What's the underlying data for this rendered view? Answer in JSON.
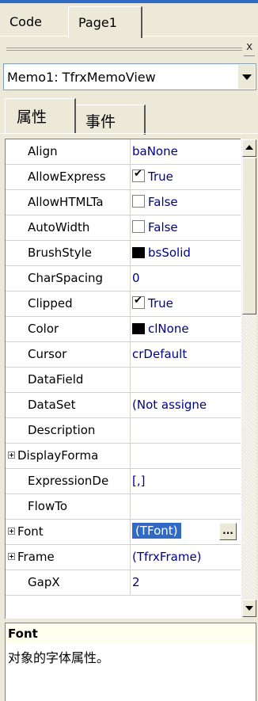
{
  "tabs": {
    "code": "Code",
    "page1": "Page1"
  },
  "panel": {
    "close_glyph": "x"
  },
  "object_selector": {
    "value": "Memo1: TfrxMemoView"
  },
  "inspector_tabs": {
    "properties": "属性",
    "events": "事件"
  },
  "properties": [
    {
      "name": "Align",
      "value": "baNone"
    },
    {
      "name": "AllowExpress",
      "value": "True",
      "checkbox": true
    },
    {
      "name": "AllowHTMLTa",
      "value": "False",
      "checkbox": false
    },
    {
      "name": "AutoWidth",
      "value": "False",
      "checkbox": false
    },
    {
      "name": "BrushStyle",
      "value": "bsSolid",
      "swatch": "#000000"
    },
    {
      "name": "CharSpacing",
      "value": "0"
    },
    {
      "name": "Clipped",
      "value": "True",
      "checkbox": true
    },
    {
      "name": "Color",
      "value": "clNone",
      "swatch": "#000000"
    },
    {
      "name": "Cursor",
      "value": "crDefault"
    },
    {
      "name": "DataField",
      "value": ""
    },
    {
      "name": "DataSet",
      "value": "(Not assigne"
    },
    {
      "name": "Description",
      "value": ""
    },
    {
      "name": "DisplayForma",
      "value": "",
      "expandable": true
    },
    {
      "name": "ExpressionDe",
      "value": "[,]"
    },
    {
      "name": "FlowTo",
      "value": ""
    },
    {
      "name": "Font",
      "value": "(TFont)",
      "expandable": true,
      "selected": true,
      "ellipsis": "..."
    },
    {
      "name": "Frame",
      "value": "(TfrxFrame)",
      "expandable": true
    },
    {
      "name": "GapX",
      "value": "2"
    }
  ],
  "description": {
    "title": "Font",
    "text": "对象的字体属性。"
  },
  "colors": {
    "selection": "#316ac5",
    "value_text": "#00008b",
    "title_bar": "#316ac5"
  }
}
